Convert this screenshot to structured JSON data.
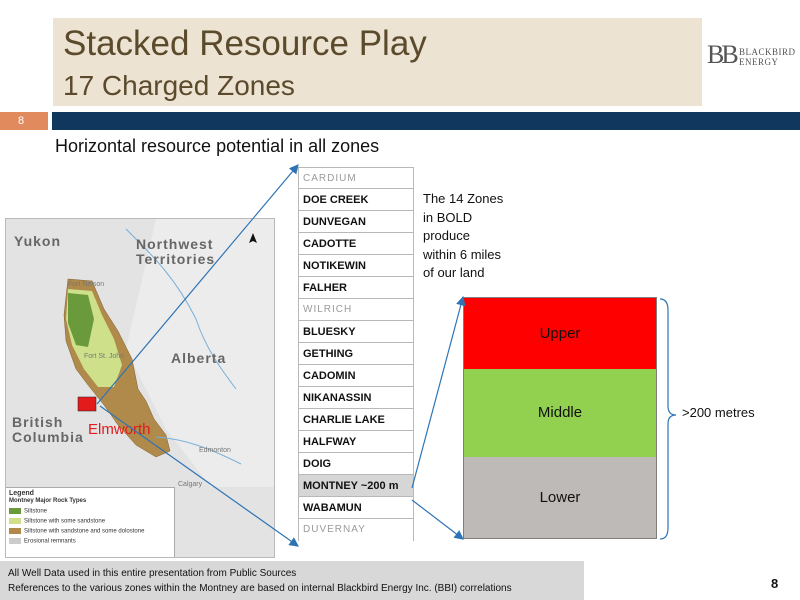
{
  "header": {
    "title": "Stacked Resource Play",
    "subtitle": "17 Charged Zones",
    "page_tab": "8"
  },
  "logo": {
    "mark": "BB",
    "line1": "BLACKBIRD",
    "line2": "ENERGY"
  },
  "slide": {
    "heading": "Horizontal resource potential in all zones",
    "note_lines": [
      "The 14 Zones",
      "in BOLD",
      "produce",
      "within 6 miles",
      "of our land"
    ],
    "thickness_label": ">200 metres"
  },
  "map": {
    "regions": {
      "yukon": "Yukon",
      "nwt": "Northwest Territories",
      "alberta": "Alberta",
      "bc": "British Columbia"
    },
    "places": {
      "fort_nelson": "Fort Nelson",
      "fort_st_john": "Fort St. John",
      "edmonton": "Edmonton",
      "calgary": "Calgary"
    },
    "highlight": "Elmworth",
    "legend": {
      "title": "Legend",
      "subtitle": "Montney Major Rock Types",
      "items": [
        {
          "label": "Siltstone",
          "color": "#6a9a3c"
        },
        {
          "label": "Siltstone with some sandstone",
          "color": "#cfe08a"
        },
        {
          "label": "Siltstone with sandstone and some dolostone",
          "color": "#b08a4a"
        },
        {
          "label": "Erosional remnants",
          "color": "#cccccc"
        }
      ]
    },
    "colors": {
      "siltstone": "#6a9a3c",
      "sandstone": "#cfe08a",
      "dolostone": "#b08a4a",
      "highlight_box": "#e31b1b"
    }
  },
  "zones": [
    {
      "name": "CARDIUM",
      "bold": false
    },
    {
      "name": "DOE CREEK",
      "bold": true
    },
    {
      "name": "DUNVEGAN",
      "bold": true
    },
    {
      "name": "CADOTTE",
      "bold": true
    },
    {
      "name": "NOTIKEWIN",
      "bold": true
    },
    {
      "name": "FALHER",
      "bold": true
    },
    {
      "name": "WILRICH",
      "bold": false
    },
    {
      "name": "BLUESKY",
      "bold": true
    },
    {
      "name": "GETHING",
      "bold": true
    },
    {
      "name": "CADOMIN",
      "bold": true
    },
    {
      "name": "NIKANASSIN",
      "bold": true
    },
    {
      "name": "CHARLIE LAKE",
      "bold": true
    },
    {
      "name": "HALFWAY",
      "bold": true
    },
    {
      "name": "DOIG",
      "bold": true
    },
    {
      "name": "MONTNEY ~200 m",
      "bold": true,
      "highlight": true
    },
    {
      "name": "WABAMUN",
      "bold": true
    },
    {
      "name": "DUVERNAY",
      "bold": false
    }
  ],
  "montney_stack": {
    "upper": "Upper",
    "middle": "Middle",
    "lower": "Lower",
    "colors": {
      "upper": "#fe0000",
      "middle": "#92d050",
      "lower": "#bdbab8"
    }
  },
  "footer": {
    "line1": "All Well Data used in this entire presentation from Public Sources",
    "line2": "References to the various zones within the Montney are based on internal Blackbird Energy Inc. (BBI) correlations",
    "page_number": "8"
  }
}
